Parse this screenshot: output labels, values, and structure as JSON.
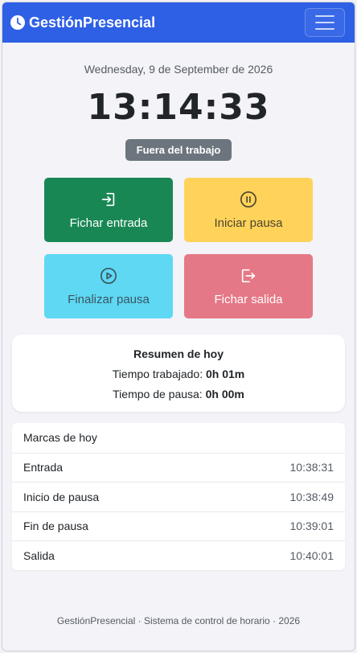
{
  "navbar": {
    "brand": "GestiónPresencial"
  },
  "date_text": "Wednesday, 9 de September de 2026",
  "clock_text": "13:14:33",
  "status_badge": "Fuera del trabajo",
  "actions": [
    {
      "label": "Fichar entrada",
      "icon": "login-icon",
      "color": "#198754"
    },
    {
      "label": "Iniciar pausa",
      "icon": "pause-circle-icon",
      "color": "#ffd35a"
    },
    {
      "label": "Finalizar pausa",
      "icon": "play-circle-icon",
      "color": "#5ed8f3"
    },
    {
      "label": "Fichar salida",
      "icon": "logout-icon",
      "color": "#e57886"
    }
  ],
  "summary": {
    "title": "Resumen de hoy",
    "worked_label": "Tiempo trabajado:",
    "worked_value": "0h 01m",
    "pause_label": "Tiempo de pausa:",
    "pause_value": "0h 00m"
  },
  "marks": {
    "title": "Marcas de hoy",
    "items": [
      {
        "label": "Entrada",
        "time": "10:38:31"
      },
      {
        "label": "Inicio de pausa",
        "time": "10:38:49"
      },
      {
        "label": "Fin de pausa",
        "time": "10:39:01"
      },
      {
        "label": "Salida",
        "time": "10:40:01"
      }
    ]
  },
  "footer": "GestiónPresencial · Sistema de control de horario · 2026",
  "colors": {
    "primary": "#2e60e6",
    "badge": "#6c757d"
  }
}
